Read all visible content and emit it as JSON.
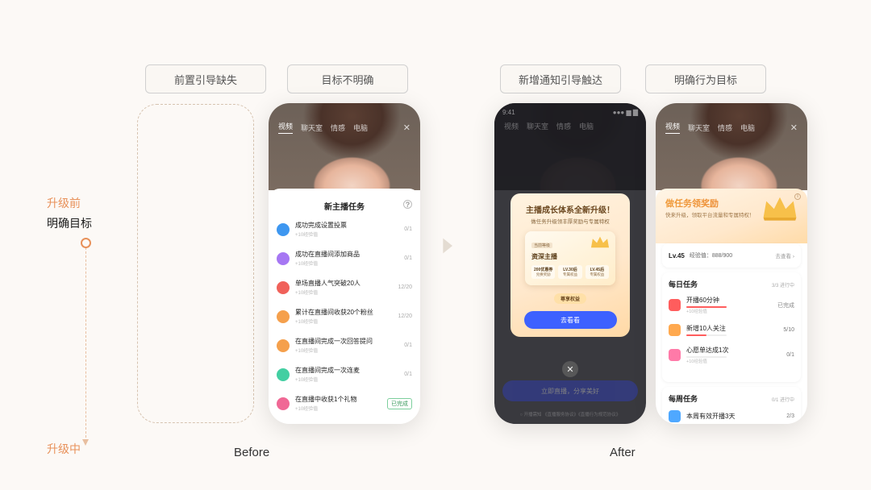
{
  "stage": {
    "before_upgrade": "升级前",
    "clear_goal": "明确目标",
    "during_upgrade": "升级中"
  },
  "tags": {
    "t1": "前置引导缺失",
    "t2": "目标不明确",
    "t3": "新增通知引导触达",
    "t4": "明确行为目标"
  },
  "labels": {
    "before": "Before",
    "after": "After"
  },
  "phone_common": {
    "time": "9:41",
    "tabs": [
      "视频",
      "聊天室",
      "情感",
      "电脑"
    ]
  },
  "before_phone": {
    "sheet_title": "新主播任务",
    "tasks": [
      {
        "title": "成功完成设置投票",
        "sub": "+10经验值",
        "progress": "0/1"
      },
      {
        "title": "成功在直播间添加商品",
        "sub": "+10经验值",
        "progress": "0/1"
      },
      {
        "title": "单场直播人气突破20人",
        "sub": "+10经验值",
        "progress": "12/20"
      },
      {
        "title": "累计在直播间收获20个粉丝",
        "sub": "+10经验值",
        "progress": "12/20"
      },
      {
        "title": "在直播间完成一次回答提问",
        "sub": "+10经验值",
        "progress": "0/1"
      },
      {
        "title": "在直播间完成一次连麦",
        "sub": "+10经验值",
        "progress": "0/1"
      },
      {
        "title": "在直播中收获1个礼物",
        "sub": "+10经验值",
        "done": "已完成"
      }
    ]
  },
  "after_modal": {
    "header_tabs": [
      "视频",
      "聊天室",
      "情感",
      "电脑"
    ],
    "title": "主播成长体系全新升级！",
    "subtitle": "做任务升级领丰厚奖励与专属特权",
    "card_tag": "当前等级",
    "card_main": "资深主播",
    "badges": [
      {
        "n": "200优惠券",
        "d": "兑换奖励"
      },
      {
        "n": "LV.30后",
        "d": "专属权益"
      },
      {
        "n": "LV.45后",
        "d": "专属权益"
      }
    ],
    "pill": "尊享权益",
    "button": "去看看",
    "bottom_bar": "立即直播，分享美好",
    "footer": "○ 开播需知 《直播服务协议》《直播行为规范协议》"
  },
  "after_reward": {
    "hero_title": "做任务领奖励",
    "hero_sub": "快来升级，领取平台流量和专属特权！",
    "level": "Lv.45",
    "exp": "经验值：888/900",
    "goview": "去查看",
    "daily": {
      "title": "每日任务",
      "status": "3/3 进行中",
      "tasks": [
        {
          "title": "开播60分钟",
          "sub": "+10经验值",
          "done": "已完成",
          "fill": "100%"
        },
        {
          "title": "新增10人关注",
          "sub": "",
          "progress": "5/10",
          "fill": "50%"
        },
        {
          "title": "心愿单达成1次",
          "sub": "+10经验值",
          "progress": "0/1",
          "fill": "0%"
        }
      ]
    },
    "weekly": {
      "title": "每周任务",
      "status": "0/1 进行中",
      "tasks": [
        {
          "title": "本周有效开播3天",
          "progress": "2/3",
          "fill": "66%"
        }
      ]
    }
  }
}
